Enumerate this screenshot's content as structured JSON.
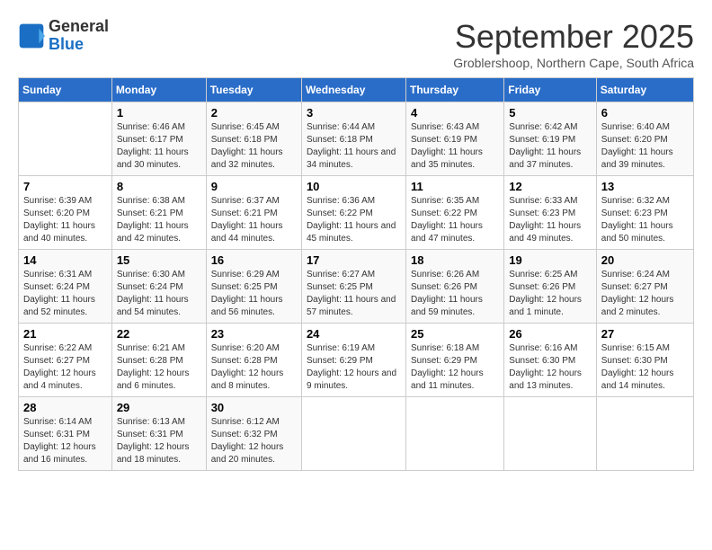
{
  "logo": {
    "line1": "General",
    "line2": "Blue"
  },
  "title": "September 2025",
  "subtitle": "Groblershoop, Northern Cape, South Africa",
  "weekdays": [
    "Sunday",
    "Monday",
    "Tuesday",
    "Wednesday",
    "Thursday",
    "Friday",
    "Saturday"
  ],
  "weeks": [
    [
      {
        "day": "",
        "sunrise": "",
        "sunset": "",
        "daylight": ""
      },
      {
        "day": "1",
        "sunrise": "Sunrise: 6:46 AM",
        "sunset": "Sunset: 6:17 PM",
        "daylight": "Daylight: 11 hours and 30 minutes."
      },
      {
        "day": "2",
        "sunrise": "Sunrise: 6:45 AM",
        "sunset": "Sunset: 6:18 PM",
        "daylight": "Daylight: 11 hours and 32 minutes."
      },
      {
        "day": "3",
        "sunrise": "Sunrise: 6:44 AM",
        "sunset": "Sunset: 6:18 PM",
        "daylight": "Daylight: 11 hours and 34 minutes."
      },
      {
        "day": "4",
        "sunrise": "Sunrise: 6:43 AM",
        "sunset": "Sunset: 6:19 PM",
        "daylight": "Daylight: 11 hours and 35 minutes."
      },
      {
        "day": "5",
        "sunrise": "Sunrise: 6:42 AM",
        "sunset": "Sunset: 6:19 PM",
        "daylight": "Daylight: 11 hours and 37 minutes."
      },
      {
        "day": "6",
        "sunrise": "Sunrise: 6:40 AM",
        "sunset": "Sunset: 6:20 PM",
        "daylight": "Daylight: 11 hours and 39 minutes."
      }
    ],
    [
      {
        "day": "7",
        "sunrise": "Sunrise: 6:39 AM",
        "sunset": "Sunset: 6:20 PM",
        "daylight": "Daylight: 11 hours and 40 minutes."
      },
      {
        "day": "8",
        "sunrise": "Sunrise: 6:38 AM",
        "sunset": "Sunset: 6:21 PM",
        "daylight": "Daylight: 11 hours and 42 minutes."
      },
      {
        "day": "9",
        "sunrise": "Sunrise: 6:37 AM",
        "sunset": "Sunset: 6:21 PM",
        "daylight": "Daylight: 11 hours and 44 minutes."
      },
      {
        "day": "10",
        "sunrise": "Sunrise: 6:36 AM",
        "sunset": "Sunset: 6:22 PM",
        "daylight": "Daylight: 11 hours and 45 minutes."
      },
      {
        "day": "11",
        "sunrise": "Sunrise: 6:35 AM",
        "sunset": "Sunset: 6:22 PM",
        "daylight": "Daylight: 11 hours and 47 minutes."
      },
      {
        "day": "12",
        "sunrise": "Sunrise: 6:33 AM",
        "sunset": "Sunset: 6:23 PM",
        "daylight": "Daylight: 11 hours and 49 minutes."
      },
      {
        "day": "13",
        "sunrise": "Sunrise: 6:32 AM",
        "sunset": "Sunset: 6:23 PM",
        "daylight": "Daylight: 11 hours and 50 minutes."
      }
    ],
    [
      {
        "day": "14",
        "sunrise": "Sunrise: 6:31 AM",
        "sunset": "Sunset: 6:24 PM",
        "daylight": "Daylight: 11 hours and 52 minutes."
      },
      {
        "day": "15",
        "sunrise": "Sunrise: 6:30 AM",
        "sunset": "Sunset: 6:24 PM",
        "daylight": "Daylight: 11 hours and 54 minutes."
      },
      {
        "day": "16",
        "sunrise": "Sunrise: 6:29 AM",
        "sunset": "Sunset: 6:25 PM",
        "daylight": "Daylight: 11 hours and 56 minutes."
      },
      {
        "day": "17",
        "sunrise": "Sunrise: 6:27 AM",
        "sunset": "Sunset: 6:25 PM",
        "daylight": "Daylight: 11 hours and 57 minutes."
      },
      {
        "day": "18",
        "sunrise": "Sunrise: 6:26 AM",
        "sunset": "Sunset: 6:26 PM",
        "daylight": "Daylight: 11 hours and 59 minutes."
      },
      {
        "day": "19",
        "sunrise": "Sunrise: 6:25 AM",
        "sunset": "Sunset: 6:26 PM",
        "daylight": "Daylight: 12 hours and 1 minute."
      },
      {
        "day": "20",
        "sunrise": "Sunrise: 6:24 AM",
        "sunset": "Sunset: 6:27 PM",
        "daylight": "Daylight: 12 hours and 2 minutes."
      }
    ],
    [
      {
        "day": "21",
        "sunrise": "Sunrise: 6:22 AM",
        "sunset": "Sunset: 6:27 PM",
        "daylight": "Daylight: 12 hours and 4 minutes."
      },
      {
        "day": "22",
        "sunrise": "Sunrise: 6:21 AM",
        "sunset": "Sunset: 6:28 PM",
        "daylight": "Daylight: 12 hours and 6 minutes."
      },
      {
        "day": "23",
        "sunrise": "Sunrise: 6:20 AM",
        "sunset": "Sunset: 6:28 PM",
        "daylight": "Daylight: 12 hours and 8 minutes."
      },
      {
        "day": "24",
        "sunrise": "Sunrise: 6:19 AM",
        "sunset": "Sunset: 6:29 PM",
        "daylight": "Daylight: 12 hours and 9 minutes."
      },
      {
        "day": "25",
        "sunrise": "Sunrise: 6:18 AM",
        "sunset": "Sunset: 6:29 PM",
        "daylight": "Daylight: 12 hours and 11 minutes."
      },
      {
        "day": "26",
        "sunrise": "Sunrise: 6:16 AM",
        "sunset": "Sunset: 6:30 PM",
        "daylight": "Daylight: 12 hours and 13 minutes."
      },
      {
        "day": "27",
        "sunrise": "Sunrise: 6:15 AM",
        "sunset": "Sunset: 6:30 PM",
        "daylight": "Daylight: 12 hours and 14 minutes."
      }
    ],
    [
      {
        "day": "28",
        "sunrise": "Sunrise: 6:14 AM",
        "sunset": "Sunset: 6:31 PM",
        "daylight": "Daylight: 12 hours and 16 minutes."
      },
      {
        "day": "29",
        "sunrise": "Sunrise: 6:13 AM",
        "sunset": "Sunset: 6:31 PM",
        "daylight": "Daylight: 12 hours and 18 minutes."
      },
      {
        "day": "30",
        "sunrise": "Sunrise: 6:12 AM",
        "sunset": "Sunset: 6:32 PM",
        "daylight": "Daylight: 12 hours and 20 minutes."
      },
      {
        "day": "",
        "sunrise": "",
        "sunset": "",
        "daylight": ""
      },
      {
        "day": "",
        "sunrise": "",
        "sunset": "",
        "daylight": ""
      },
      {
        "day": "",
        "sunrise": "",
        "sunset": "",
        "daylight": ""
      },
      {
        "day": "",
        "sunrise": "",
        "sunset": "",
        "daylight": ""
      }
    ]
  ]
}
